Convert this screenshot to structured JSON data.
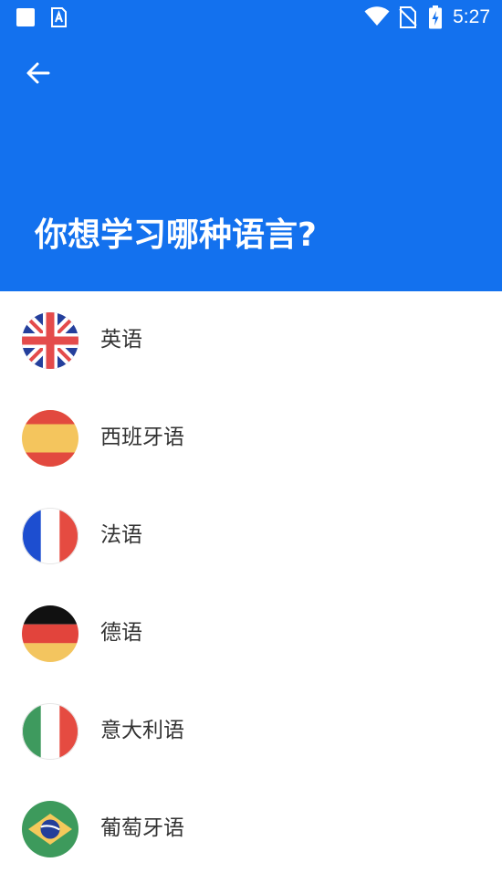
{
  "status_bar": {
    "time": "5:27",
    "icons": [
      "square-notification-icon",
      "app-a-icon",
      "wifi-icon",
      "no-sim-icon",
      "battery-charging-icon"
    ]
  },
  "header": {
    "back_icon": "arrow-left-icon",
    "title": "你想学习哪种语言?",
    "background_color": "#1371ee"
  },
  "languages": [
    {
      "label": "英语",
      "flag": "uk-flag-icon"
    },
    {
      "label": "西班牙语",
      "flag": "spain-flag-icon"
    },
    {
      "label": "法语",
      "flag": "france-flag-icon"
    },
    {
      "label": "德语",
      "flag": "germany-flag-icon"
    },
    {
      "label": "意大利语",
      "flag": "italy-flag-icon"
    },
    {
      "label": "葡萄牙语",
      "flag": "brazil-flag-icon"
    }
  ]
}
